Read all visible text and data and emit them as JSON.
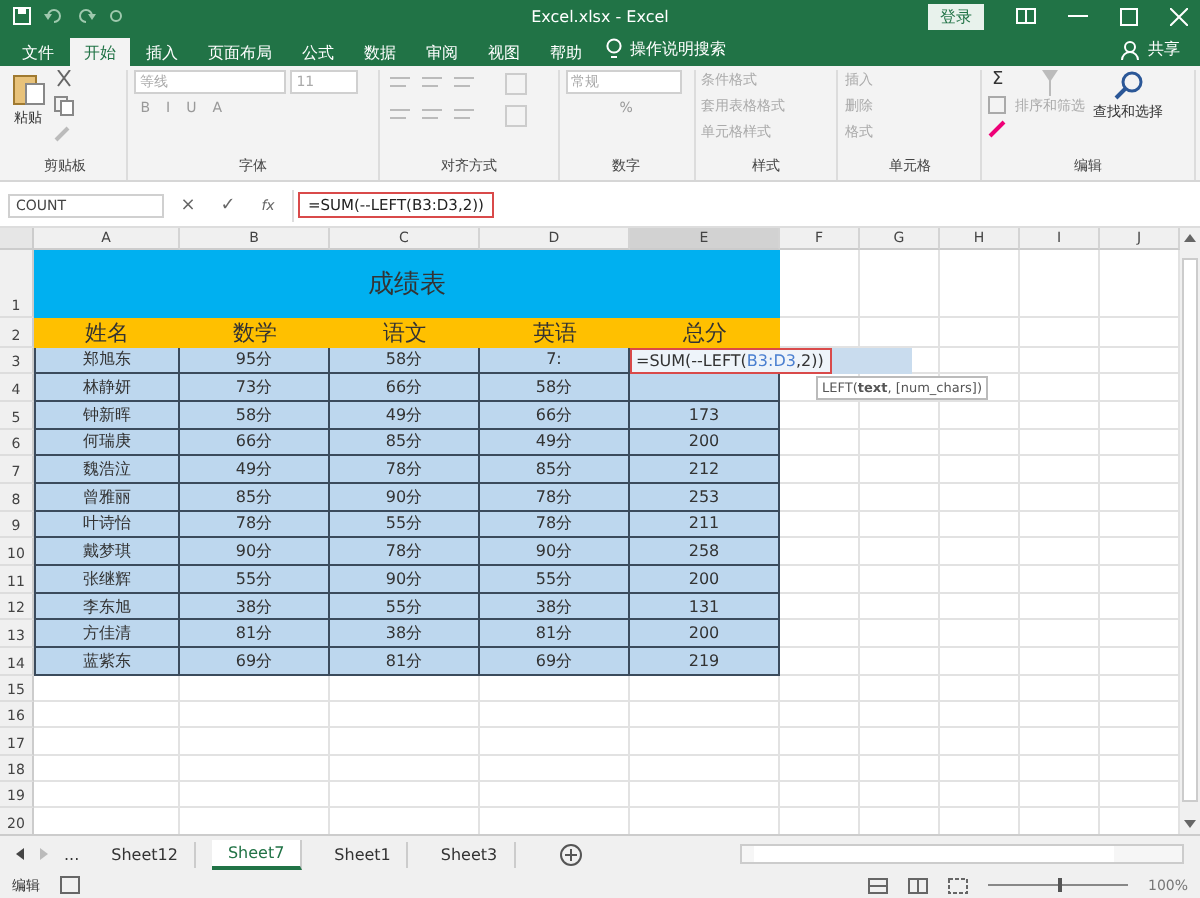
{
  "title_bar": {
    "title": "Excel.xlsx - Excel",
    "login_button": "登录"
  },
  "ribbon_tabs": [
    {
      "label": "文件",
      "selected": false
    },
    {
      "label": "开始",
      "selected": true
    },
    {
      "label": "插入",
      "selected": false
    },
    {
      "label": "页面布局",
      "selected": false
    },
    {
      "label": "公式",
      "selected": false
    },
    {
      "label": "数据",
      "selected": false
    },
    {
      "label": "审阅",
      "selected": false
    },
    {
      "label": "视图",
      "selected": false
    },
    {
      "label": "帮助",
      "selected": false
    }
  ],
  "tell_me": "操作说明搜索",
  "share": "共享",
  "ribbon_groups": [
    {
      "kind": "clipboard",
      "label": "剪贴板",
      "items": [
        "粘贴"
      ]
    },
    {
      "kind": "font",
      "label": "字体",
      "items": [
        "等线",
        "11",
        "B",
        "I",
        "U",
        "A"
      ]
    },
    {
      "kind": "alignment",
      "label": "对齐方式"
    },
    {
      "kind": "number",
      "label": "数字",
      "items": [
        "常规",
        "%"
      ]
    },
    {
      "kind": "list",
      "label": "样式",
      "items": [
        "条件格式",
        "套用表格格式",
        "单元格样式"
      ]
    },
    {
      "kind": "list",
      "label": "单元格",
      "items": [
        "插入",
        "删除",
        "格式"
      ]
    },
    {
      "kind": "editing",
      "label": "编辑",
      "items": [
        "Σ",
        "排序和筛选",
        "查找和选择"
      ]
    }
  ],
  "formula_bar": {
    "name_box": "COUNT",
    "cancel": "×",
    "enter": "✓",
    "fx": "fx",
    "formula": "=SUM(--LEFT(B3:D3,2))"
  },
  "columns": [
    {
      "label": "A",
      "selected": false
    },
    {
      "label": "B",
      "selected": false
    },
    {
      "label": "C",
      "selected": false
    },
    {
      "label": "D",
      "selected": false
    },
    {
      "label": "E",
      "selected": true
    },
    {
      "label": "F",
      "selected": false
    },
    {
      "label": "G",
      "selected": false
    },
    {
      "label": "H",
      "selected": false
    },
    {
      "label": "I",
      "selected": false
    },
    {
      "label": "J",
      "selected": false
    }
  ],
  "table_title": {
    "row": "1",
    "text": "成绩表"
  },
  "header_row": {
    "row": "2",
    "cells": [
      "姓名",
      "数学",
      "语文",
      "英语",
      "总分"
    ]
  },
  "rows": [
    {
      "row": "3",
      "selected": true,
      "cells": [
        "郑旭东",
        "95分",
        "58分",
        "7:"
      ],
      "formula": {
        "prefix": "=SUM(--LEFT(",
        "reference": "B3:D3",
        "suffix": ",2))"
      }
    },
    {
      "row": "4",
      "selected": true,
      "cells": [
        "林静妍",
        "73分",
        "66分",
        "58分"
      ]
    },
    {
      "row": "5",
      "selected": true,
      "cells": [
        "钟新晖",
        "58分",
        "49分",
        "66分",
        "173"
      ]
    },
    {
      "row": "6",
      "selected": true,
      "cells": [
        "何瑞庚",
        "66分",
        "85分",
        "49分",
        "200"
      ]
    },
    {
      "row": "7",
      "selected": true,
      "cells": [
        "魏浩泣",
        "49分",
        "78分",
        "85分",
        "212"
      ]
    },
    {
      "row": "8",
      "selected": true,
      "cells": [
        "曾雅丽",
        "85分",
        "90分",
        "78分",
        "253"
      ]
    },
    {
      "row": "9",
      "selected": true,
      "cells": [
        "叶诗怡",
        "78分",
        "55分",
        "78分",
        "211"
      ]
    },
    {
      "row": "10",
      "selected": true,
      "cells": [
        "戴梦琪",
        "90分",
        "78分",
        "90分",
        "258"
      ]
    },
    {
      "row": "11",
      "selected": true,
      "cells": [
        "张继辉",
        "55分",
        "90分",
        "55分",
        "200"
      ]
    },
    {
      "row": "12",
      "selected": true,
      "cells": [
        "李东旭",
        "38分",
        "55分",
        "38分",
        "131"
      ]
    },
    {
      "row": "13",
      "selected": true,
      "cells": [
        "方佳清",
        "81分",
        "38分",
        "81分",
        "200"
      ]
    },
    {
      "row": "14",
      "selected": true,
      "cells": [
        "蓝紫东",
        "69分",
        "81分",
        "69分",
        "219"
      ]
    }
  ],
  "blank_rows": [
    "15",
    "16",
    "17",
    "18",
    "19",
    "20"
  ],
  "tooltip": "LEFT(**text**, [num_chars])",
  "sheet_tabs": {
    "more": "...",
    "tabs": [
      {
        "label": "Sheet12",
        "selected": false
      },
      {
        "label": "Sheet7",
        "selected": true
      },
      {
        "label": "Sheet1",
        "selected": false
      },
      {
        "label": "Sheet3",
        "selected": false
      }
    ]
  },
  "status_bar": {
    "mode": "编辑",
    "zoom": {
      "level": 0.5,
      "reading": "100%"
    }
  }
}
